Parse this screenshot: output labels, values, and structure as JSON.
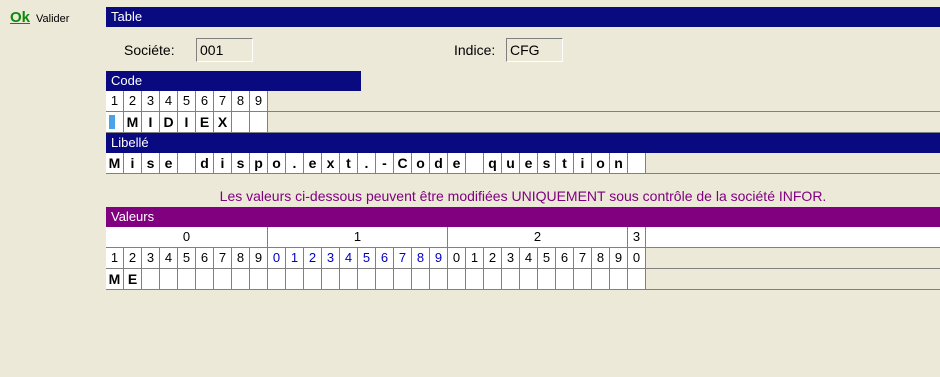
{
  "toolbar": {
    "ok_label": "Ok",
    "validate_label": "Valider"
  },
  "table_bar": "Table",
  "societe": {
    "label": "Sociéte:",
    "value": "001"
  },
  "indice": {
    "label": "Indice:",
    "value": "CFG"
  },
  "code": {
    "title": "Code",
    "digits": [
      "1",
      "2",
      "3",
      "4",
      "5",
      "6",
      "7",
      "8",
      "9"
    ],
    "chars": [
      "",
      "M",
      "I",
      "D",
      "I",
      "E",
      "X",
      "",
      ""
    ]
  },
  "libelle": {
    "title": "Libellé",
    "chars": [
      "M",
      "i",
      "s",
      "e",
      "",
      "d",
      "i",
      "s",
      "p",
      "o",
      ".",
      "e",
      "x",
      "t",
      ".",
      "-",
      "C",
      "o",
      "d",
      "e",
      "",
      "q",
      "u",
      "e",
      "s",
      "t",
      "i",
      "o",
      "n",
      ""
    ]
  },
  "notice": "Les valeurs ci-dessous peuvent être modifiées UNIQUEMENT sous contrôle de la société INFOR.",
  "valeurs": {
    "title": "Valeurs",
    "groups": [
      "0",
      "1",
      "2",
      "3"
    ],
    "digits": [
      "1",
      "2",
      "3",
      "4",
      "5",
      "6",
      "7",
      "8",
      "9",
      "0",
      "1",
      "2",
      "3",
      "4",
      "5",
      "6",
      "7",
      "8",
      "9",
      "0",
      "1",
      "2",
      "3",
      "4",
      "5",
      "6",
      "7",
      "8",
      "9",
      "0"
    ],
    "chars": [
      "M",
      "E",
      "",
      "",
      "",
      "",
      "",
      "",
      "",
      "",
      "",
      "",
      "",
      "",
      "",
      "",
      "",
      "",
      "",
      "",
      "",
      "",
      "",
      "",
      "",
      "",
      "",
      "",
      "",
      ""
    ]
  },
  "colors": {
    "header": "#0a0a80",
    "purple": "#800080",
    "ok_green": "#0a8a0a"
  }
}
